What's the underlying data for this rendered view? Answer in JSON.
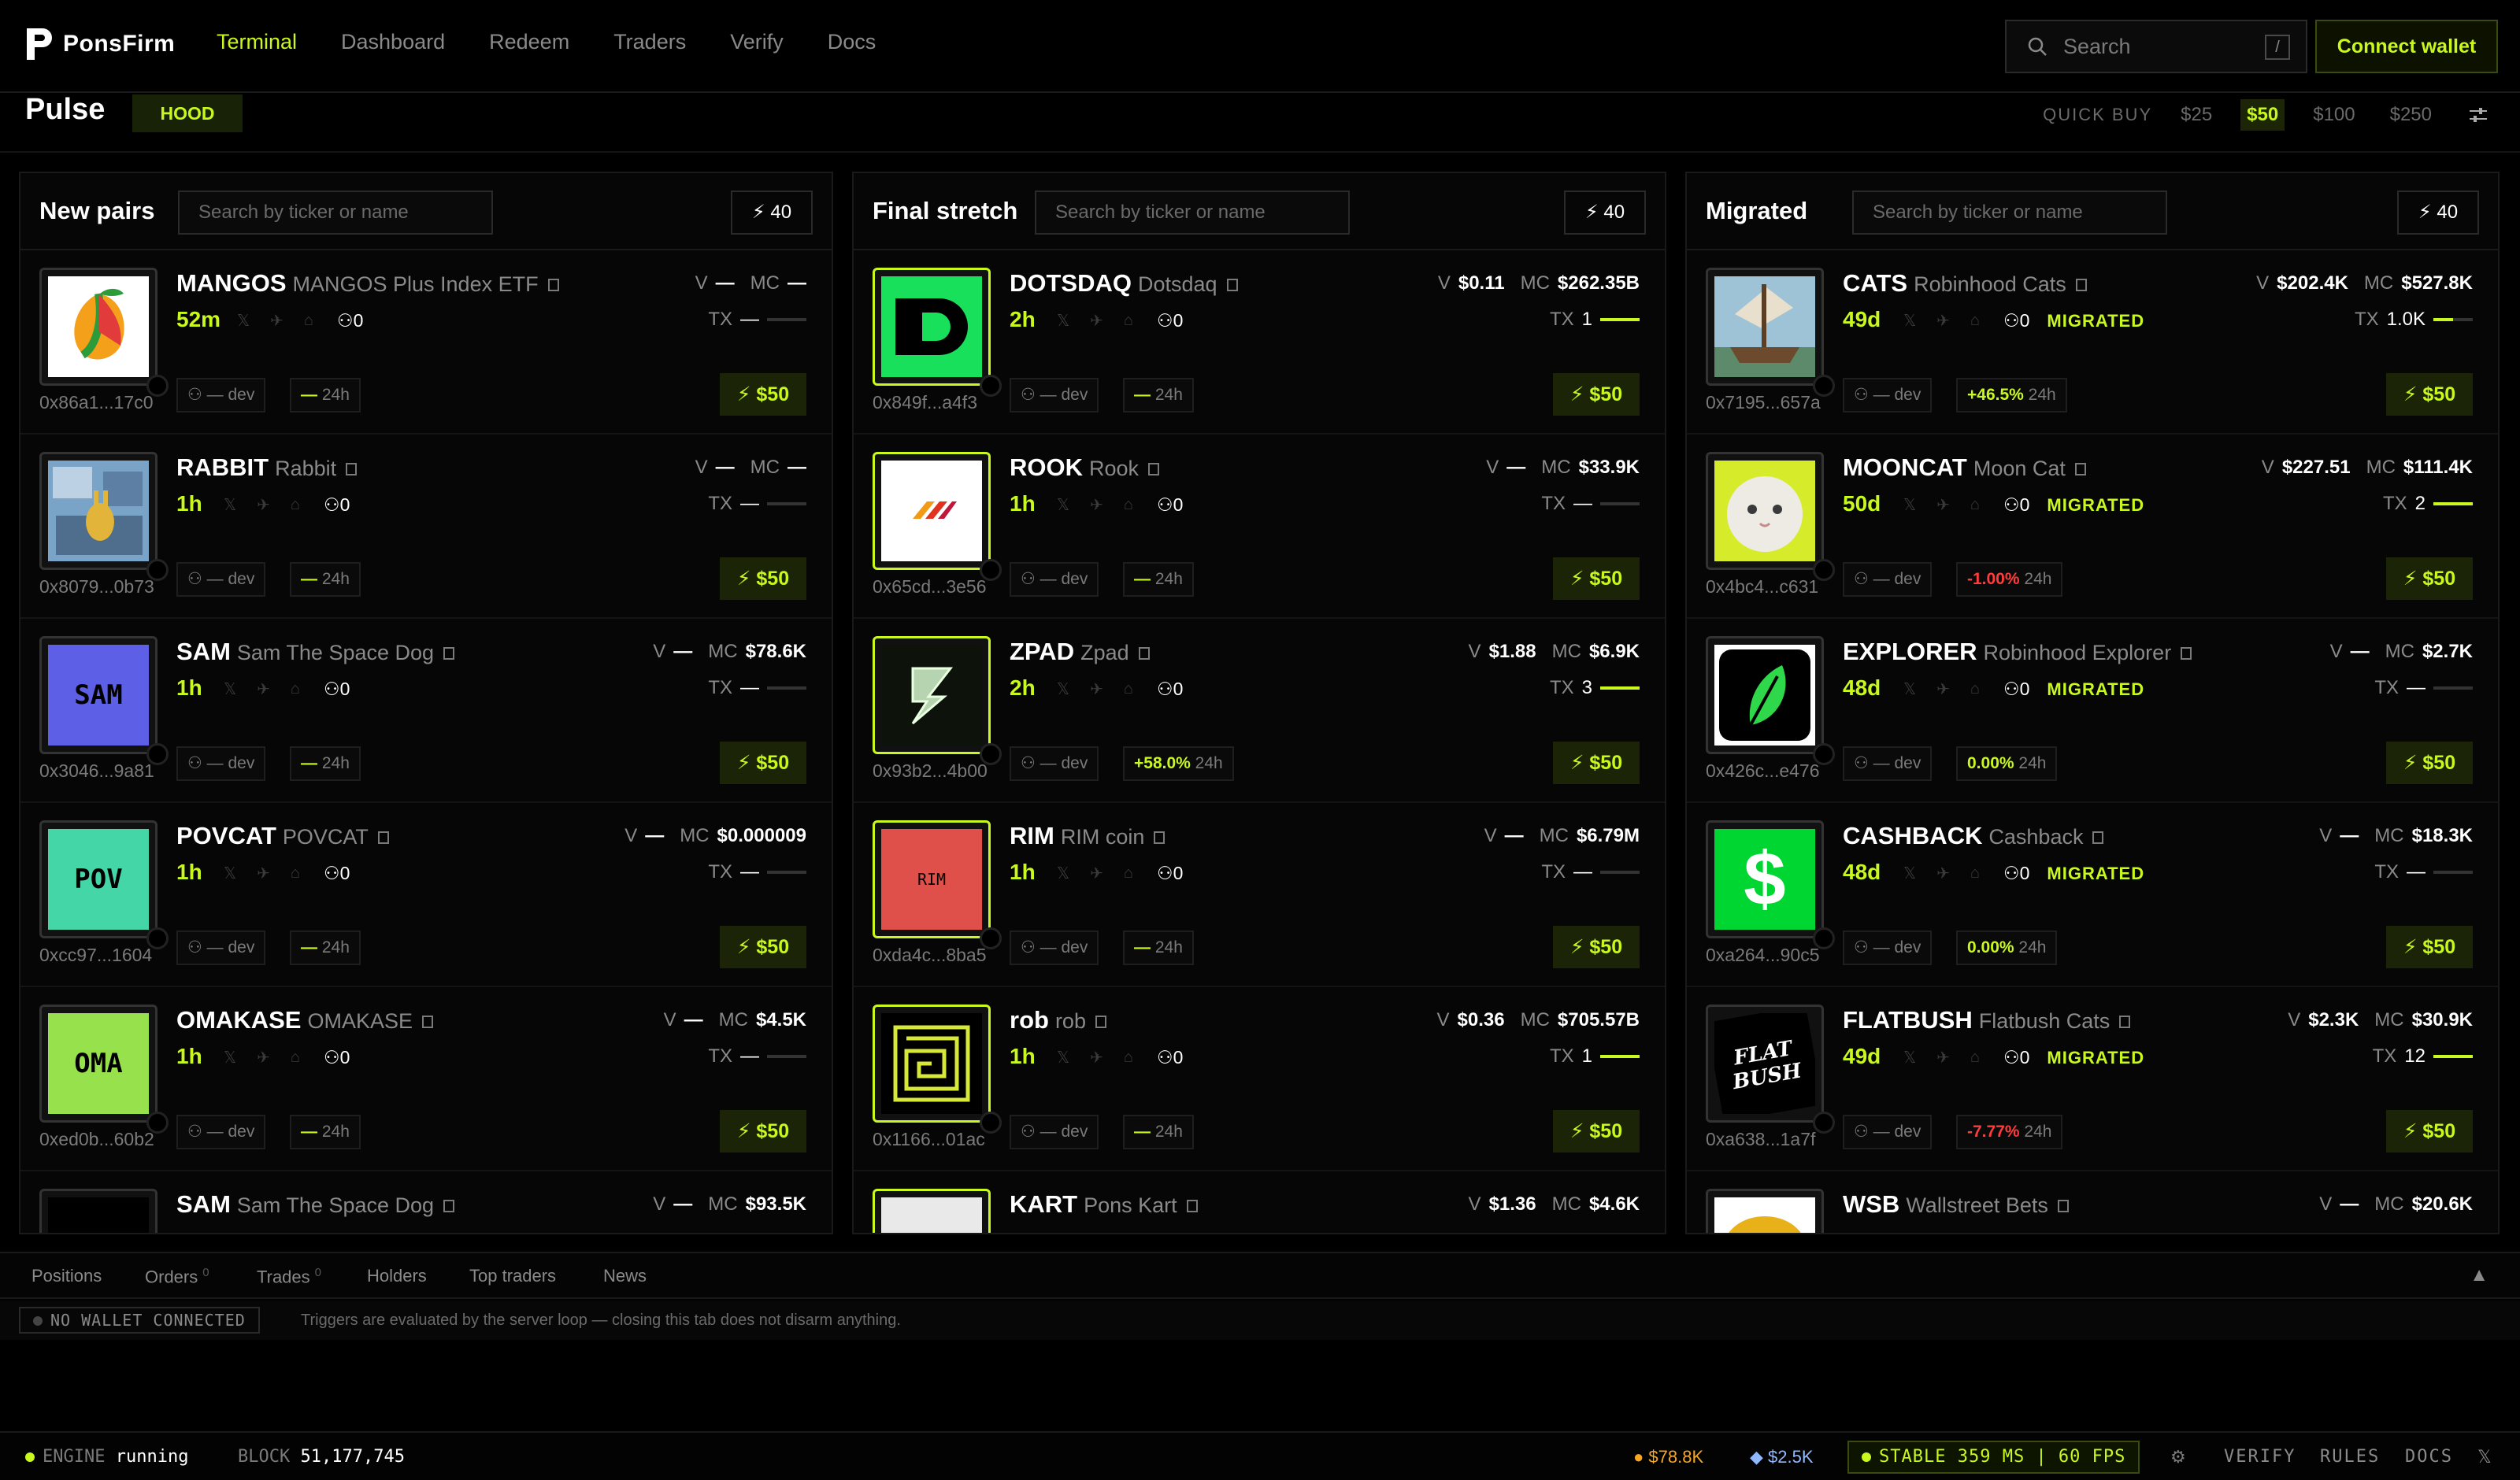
{
  "app": {
    "name": "PonsFirm"
  },
  "nav": [
    "Terminal",
    "Dashboard",
    "Redeem",
    "Traders",
    "Verify",
    "Docs"
  ],
  "search": {
    "placeholder": "Search",
    "shortcut": "/"
  },
  "connect_label": "Connect wallet",
  "pulse": {
    "title": "Pulse",
    "chip": "HOOD"
  },
  "quick_buy": {
    "label": "QUICK BUY",
    "options": [
      "$25",
      "$50",
      "$100",
      "$250"
    ],
    "selected": "$50"
  },
  "columns": [
    {
      "title": "New pairs",
      "search_placeholder": "Search by ticker or name",
      "count": "40",
      "cards": [
        {
          "ticker": "MANGOS",
          "name": "MANGOS Plus Index ETF",
          "age": "52m",
          "holders": "0",
          "v": "—",
          "mc": "—",
          "tx": "—",
          "dev": "— dev",
          "change": "—",
          "period": "24h",
          "addr": "0x86a1...17c0",
          "buy": "$50",
          "thumb": "mango"
        },
        {
          "ticker": "RABBIT",
          "name": "Rabbit",
          "age": "1h",
          "holders": "0",
          "v": "—",
          "mc": "—",
          "tx": "—",
          "dev": "— dev",
          "change": "—",
          "period": "24h",
          "addr": "0x8079...0b73",
          "buy": "$50",
          "thumb": "rabbit"
        },
        {
          "ticker": "SAM",
          "name": "Sam The Space Dog",
          "age": "1h",
          "holders": "0",
          "v": "—",
          "mc": "$78.6K",
          "tx": "—",
          "dev": "— dev",
          "change": "—",
          "period": "24h",
          "addr": "0x3046...9a81",
          "buy": "$50",
          "thumb": "sam"
        },
        {
          "ticker": "POVCAT",
          "name": "POVCAT",
          "age": "1h",
          "holders": "0",
          "v": "—",
          "mc": "$0.000009",
          "tx": "—",
          "dev": "— dev",
          "change": "—",
          "period": "24h",
          "addr": "0xcc97...1604",
          "buy": "$50",
          "thumb": "pov"
        },
        {
          "ticker": "OMAKASE",
          "name": "OMAKASE",
          "age": "1h",
          "holders": "0",
          "v": "—",
          "mc": "$4.5K",
          "tx": "—",
          "dev": "— dev",
          "change": "—",
          "period": "24h",
          "addr": "0xed0b...60b2",
          "buy": "$50",
          "thumb": "oma"
        },
        {
          "ticker": "SAM",
          "name": "Sam The Space Dog",
          "age": "",
          "holders": "",
          "v": "—",
          "mc": "$93.5K",
          "tx": "",
          "dev": "",
          "change": "",
          "period": "",
          "addr": "",
          "buy": "",
          "thumb": "space"
        }
      ]
    },
    {
      "title": "Final stretch",
      "search_placeholder": "Search by ticker or name",
      "count": "40",
      "cards": [
        {
          "ticker": "DOTSDAQ",
          "name": "Dotsdaq",
          "age": "2h",
          "holders": "0",
          "v": "$0.11",
          "mc": "$262.35B",
          "tx": "1",
          "dev": "— dev",
          "change": "—",
          "period": "24h",
          "addr": "0x849f...a4f3",
          "buy": "$50",
          "thumb": "dots"
        },
        {
          "ticker": "ROOK",
          "name": "Rook",
          "age": "1h",
          "holders": "0",
          "v": "—",
          "mc": "$33.9K",
          "tx": "—",
          "dev": "— dev",
          "change": "—",
          "period": "24h",
          "addr": "0x65cd...3e56",
          "buy": "$50",
          "thumb": "rook"
        },
        {
          "ticker": "ZPAD",
          "name": "Zpad",
          "age": "2h",
          "holders": "0",
          "v": "$1.88",
          "mc": "$6.9K",
          "tx": "3",
          "dev": "— dev",
          "change": "+58.0%",
          "period": "24h",
          "addr": "0x93b2...4b00",
          "buy": "$50",
          "thumb": "zpad"
        },
        {
          "ticker": "RIM",
          "name": "RIM coin",
          "age": "1h",
          "holders": "0",
          "v": "—",
          "mc": "$6.79M",
          "tx": "—",
          "dev": "— dev",
          "change": "—",
          "period": "24h",
          "addr": "0xda4c...8ba5",
          "buy": "$50",
          "thumb": "rim"
        },
        {
          "ticker": "rob",
          "name": "rob",
          "age": "1h",
          "holders": "0",
          "v": "$0.36",
          "mc": "$705.57B",
          "tx": "1",
          "dev": "— dev",
          "change": "—",
          "period": "24h",
          "addr": "0x1166...01ac",
          "buy": "$50",
          "thumb": "rob"
        },
        {
          "ticker": "KART",
          "name": "Pons Kart",
          "age": "",
          "holders": "",
          "v": "$1.36",
          "mc": "$4.6K",
          "tx": "",
          "dev": "",
          "change": "",
          "period": "",
          "addr": "",
          "buy": "",
          "thumb": "kart"
        }
      ]
    },
    {
      "title": "Migrated",
      "search_placeholder": "Search by ticker or name",
      "count": "40",
      "cards": [
        {
          "ticker": "CATS",
          "name": "Robinhood Cats",
          "age": "49d",
          "holders": "0",
          "migrated": "MIGRATED",
          "v": "$202.4K",
          "mc": "$527.8K",
          "tx": "1.0K",
          "dev": "— dev",
          "change": "+46.5%",
          "period": "24h",
          "addr": "0x7195...657a",
          "buy": "$50",
          "thumb": "cats"
        },
        {
          "ticker": "MOONCAT",
          "name": "Moon Cat",
          "age": "50d",
          "holders": "0",
          "migrated": "MIGRATED",
          "v": "$227.51",
          "mc": "$111.4K",
          "tx": "2",
          "dev": "— dev",
          "change": "-1.00%",
          "period": "24h",
          "addr": "0x4bc4...c631",
          "buy": "$50",
          "thumb": "mooncat"
        },
        {
          "ticker": "EXPLORER",
          "name": "Robinhood Explorer",
          "age": "48d",
          "holders": "0",
          "migrated": "MIGRATED",
          "v": "—",
          "mc": "$2.7K",
          "tx": "—",
          "dev": "— dev",
          "change": "0.00%",
          "period": "24h",
          "addr": "0x426c...e476",
          "buy": "$50",
          "thumb": "explorer"
        },
        {
          "ticker": "CASHBACK",
          "name": "Cashback",
          "age": "48d",
          "holders": "0",
          "migrated": "MIGRATED",
          "v": "—",
          "mc": "$18.3K",
          "tx": "—",
          "dev": "— dev",
          "change": "0.00%",
          "period": "24h",
          "addr": "0xa264...90c5",
          "buy": "$50",
          "thumb": "cash"
        },
        {
          "ticker": "FLATBUSH",
          "name": "Flatbush Cats",
          "age": "49d",
          "holders": "0",
          "migrated": "MIGRATED",
          "v": "$2.3K",
          "mc": "$30.9K",
          "tx": "12",
          "dev": "— dev",
          "change": "-7.77%",
          "period": "24h",
          "addr": "0xa638...1a7f",
          "buy": "$50",
          "thumb": "flat"
        },
        {
          "ticker": "WSB",
          "name": "Wallstreet Bets",
          "age": "",
          "holders": "",
          "v": "—",
          "mc": "$20.6K",
          "tx": "",
          "dev": "",
          "change": "",
          "period": "",
          "addr": "",
          "buy": "",
          "thumb": "wsb"
        }
      ]
    }
  ],
  "bottom_tabs": [
    {
      "label": "Positions",
      "count": ""
    },
    {
      "label": "Orders",
      "count": "0"
    },
    {
      "label": "Trades",
      "count": "0"
    },
    {
      "label": "Holders",
      "count": ""
    },
    {
      "label": "Top traders",
      "count": ""
    },
    {
      "label": "News",
      "count": ""
    }
  ],
  "status": {
    "wallet": "NO WALLET CONNECTED",
    "note": "Triggers are evaluated by the server loop — closing this tab does not disarm anything."
  },
  "footer": {
    "engine_label": "ENGINE",
    "engine_state": "running",
    "block_label": "BLOCK",
    "block_value": "51,177,745",
    "btc": "$78.8K",
    "eth": "$2.5K",
    "stable": "STABLE 359 MS | 60 FPS",
    "links": [
      "VERIFY",
      "RULES",
      "DOCS"
    ]
  },
  "colors": {
    "accent": "#c8f81e",
    "negative": "#ff3b3b",
    "background": "#000000"
  }
}
